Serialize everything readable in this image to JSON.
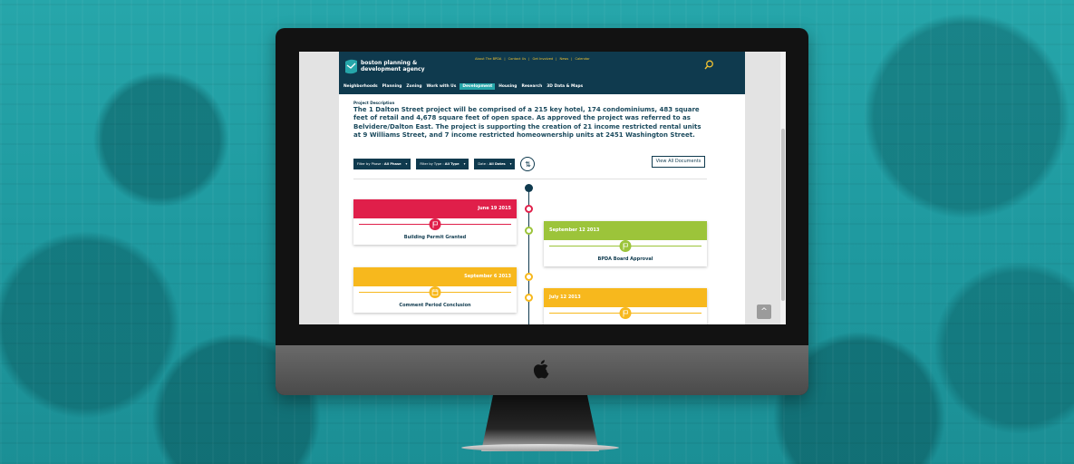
{
  "header": {
    "logo_line1": "boston planning &",
    "logo_line2": "development agency",
    "top_links": [
      "About The BPDA",
      "Contact Us",
      "Get Involved",
      "News",
      "Calendar"
    ],
    "nav": [
      "Neighborhoods",
      "Planning",
      "Zoning",
      "Work with Us",
      "Development",
      "Housing",
      "Research",
      "3D Data & Maps"
    ],
    "nav_active_index": 4
  },
  "project": {
    "label": "Project Description",
    "description": "The 1 Dalton Street project will be comprised of a 215 key hotel, 174 condominiums, 483 square feet of retail and 4,678 square feet of open space. As approved the project was referred to as Belvidere/Dalton East. The project is supporting the creation of 21 income restricted rental units at 9 Williams Street, and 7 income restricted homeownership units at 2451 Washington Street."
  },
  "filters": {
    "phase_prefix": "Filter by Phase : ",
    "phase_value": "All Phase",
    "type_prefix": "Filter by Type : ",
    "type_value": "All Type",
    "date_prefix": "Date : ",
    "date_value": "All Dates",
    "view_all": "View All Documents"
  },
  "timeline": [
    {
      "date": "June 19 2015",
      "title": "Building Permit Granted",
      "color": "#e01f4a",
      "side": "left"
    },
    {
      "date": "September 12 2013",
      "title": "BPDA Board Approval",
      "color": "#9cc43a",
      "side": "right"
    },
    {
      "date": "September 6 2013",
      "title": "Comment Period Conclusion",
      "color": "#f7b81d",
      "side": "left"
    },
    {
      "date": "July 12 2013",
      "title": "",
      "color": "#f7b81d",
      "side": "right"
    }
  ],
  "colors": {
    "brand_navy": "#0f3a4e",
    "accent_teal": "#26a6aa",
    "link_yellow": "#f1c232"
  },
  "icons": {
    "search": "search-icon",
    "sort": "sort-icon",
    "back_to_top": "chevron-up-icon",
    "milestone": "flag-icon",
    "calendar": "calendar-icon"
  }
}
